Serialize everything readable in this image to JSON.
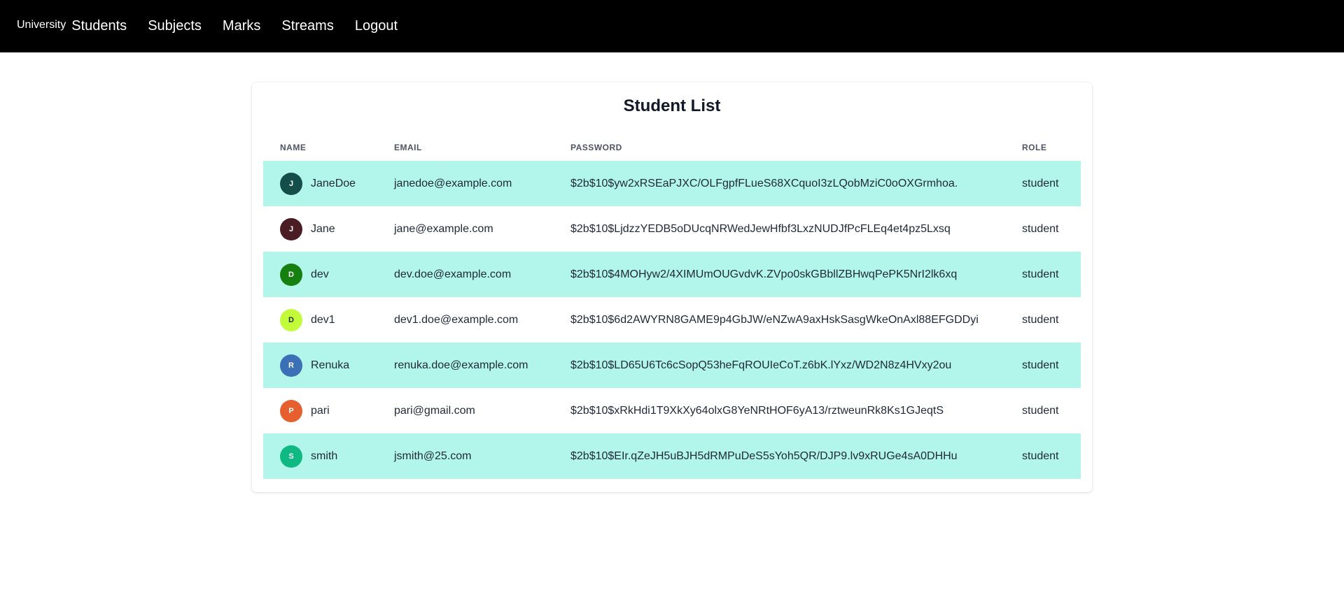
{
  "nav": {
    "brand": "University",
    "links": [
      "Students",
      "Subjects",
      "Marks",
      "Streams",
      "Logout"
    ]
  },
  "card": {
    "title": "Student List",
    "columns": [
      "NAME",
      "EMAIL",
      "PASSWORD",
      "ROLE"
    ],
    "row_highlight_color": "#b2f5ea",
    "rows": [
      {
        "initial": "J",
        "avatar_color": "#134e4a",
        "name": "JaneDoe",
        "email": "janedoe@example.com",
        "password": "$2b$10$yw2xRSEaPJXC/OLFgpfFLueS68XCquoI3zLQobMziC0oOXGrmhoa.",
        "role": "student"
      },
      {
        "initial": "J",
        "avatar_color": "#4a1d24",
        "name": "Jane",
        "email": "jane@example.com",
        "password": "$2b$10$LjdzzYEDB5oDUcqNRWedJewHfbf3LxzNUDJfPcFLEq4et4pz5Lxsq",
        "role": "student"
      },
      {
        "initial": "D",
        "avatar_color": "#15800f",
        "name": "dev",
        "email": "dev.doe@example.com",
        "password": "$2b$10$4MOHyw2/4XIMUmOUGvdvK.ZVpo0skGBbllZBHwqPePK5NrI2lk6xq",
        "role": "student"
      },
      {
        "initial": "D",
        "avatar_color": "#c1fb3a",
        "name": "dev1",
        "email": "dev1.doe@example.com",
        "password": "$2b$10$6d2AWYRN8GAME9p4GbJW/eNZwA9axHskSasgWkeOnAxl88EFGDDyi",
        "role": "student"
      },
      {
        "initial": "R",
        "avatar_color": "#3b6fb6",
        "name": "Renuka",
        "email": "renuka.doe@example.com",
        "password": "$2b$10$LD65U6Tc6cSopQ53heFqROUIeCoT.z6bK.lYxz/WD2N8z4HVxy2ou",
        "role": "student"
      },
      {
        "initial": "P",
        "avatar_color": "#e6602f",
        "name": "pari",
        "email": "pari@gmail.com",
        "password": "$2b$10$xRkHdi1T9XkXy64olxG8YeNRtHOF6yA13/rztweunRk8Ks1GJeqtS",
        "role": "student"
      },
      {
        "initial": "S",
        "avatar_color": "#10b981",
        "name": "smith",
        "email": "jsmith@25.com",
        "password": "$2b$10$EIr.qZeJH5uBJH5dRMPuDeS5sYoh5QR/DJP9.lv9xRUGe4sA0DHHu",
        "role": "student"
      }
    ]
  }
}
